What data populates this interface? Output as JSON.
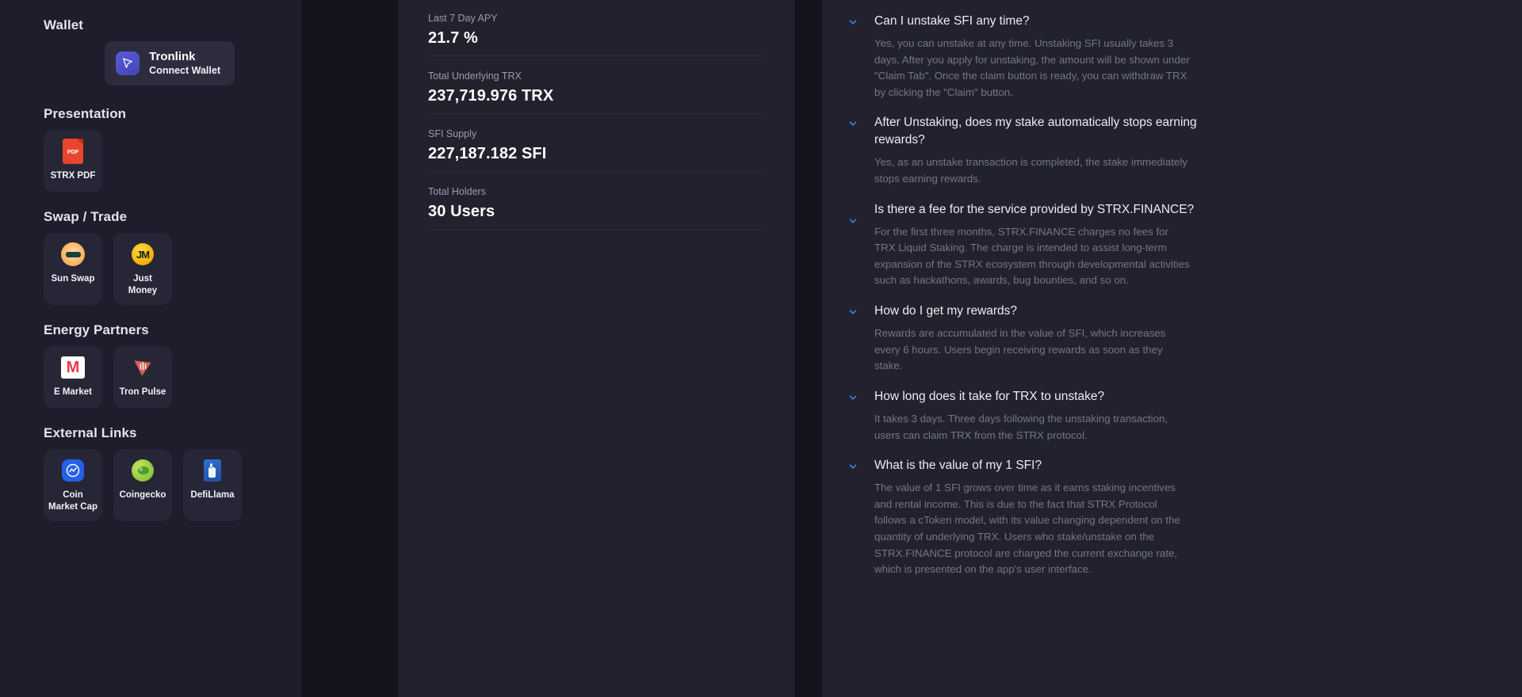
{
  "sidebar": {
    "sections": [
      {
        "title": "Wallet",
        "wallet": {
          "name": "Tronlink",
          "subtitle": "Connect Wallet",
          "icon": "tronlink-cursor-icon"
        }
      },
      {
        "title": "Presentation",
        "tiles": [
          {
            "label": "STRX PDF",
            "icon": "pdf-icon",
            "badge": "PDF"
          }
        ]
      },
      {
        "title": "Swap / Trade",
        "tiles": [
          {
            "label": "Sun Swap",
            "icon": "sunswap-icon"
          },
          {
            "label": "Just Money",
            "icon": "justmoney-icon",
            "badge": "JM"
          }
        ]
      },
      {
        "title": "Energy Partners",
        "tiles": [
          {
            "label": "E Market",
            "icon": "emarket-icon",
            "badge": "M"
          },
          {
            "label": "Tron Pulse",
            "icon": "tronpulse-icon"
          }
        ]
      },
      {
        "title": "External Links",
        "tiles": [
          {
            "label": "Coin Market Cap",
            "icon": "coinmarketcap-icon"
          },
          {
            "label": "Coingecko",
            "icon": "coingecko-icon"
          },
          {
            "label": "DefiLlama",
            "icon": "defillama-icon"
          }
        ]
      }
    ]
  },
  "stats": [
    {
      "label": "Last 7 Day APY",
      "value": "21.7 %"
    },
    {
      "label": "Total Underlying TRX",
      "value": "237,719.976 TRX"
    },
    {
      "label": "SFI Supply",
      "value": "227,187.182 SFI"
    },
    {
      "label": "Total Holders",
      "value": "30 Users"
    }
  ],
  "faq": {
    "accent_color": "#2f7fe0",
    "items": [
      {
        "question": "Can I unstake SFI any time?",
        "answer": "Yes, you can unstake at any time. Unstaking SFI usually takes 3 days. After you apply for unstaking, the amount will be shown under \"Claim Tab\". Once the claim button is ready, you can withdraw TRX by clicking the \"Claim\" button."
      },
      {
        "question": "After Unstaking, does my stake automatically stops earning rewards?",
        "answer": "Yes, as an unstake transaction is completed, the stake immediately stops earning rewards."
      },
      {
        "question": "Is there a fee for the service provided by STRX.FINANCE?",
        "answer": "For the first three months, STRX.FINANCE charges no fees for TRX Liquid Staking. The charge is intended to assist long-term expansion of the STRX ecosystem through developmental activities such as hackathons, awards, bug bounties, and so on."
      },
      {
        "question": "How do I get my rewards?",
        "answer": "Rewards are accumulated in the value of SFI, which increases every 6 hours. Users begin receiving rewards as soon as they stake."
      },
      {
        "question": "How long does it take for TRX to unstake?",
        "answer": "It takes 3 days. Three days following the unstaking transaction, users can claim TRX from the STRX protocol."
      },
      {
        "question": "What is the value of my 1 SFI?",
        "answer": "The value of 1 SFI grows over time as it earns staking incentives and rental income. This is due to the fact that STRX Protocol follows a cToken model, with its value changing dependent on the quantity of underlying TRX. Users who stake/unstake on the STRX.FINANCE protocol are charged the current exchange rate, which is presented on the app's user interface."
      }
    ]
  }
}
